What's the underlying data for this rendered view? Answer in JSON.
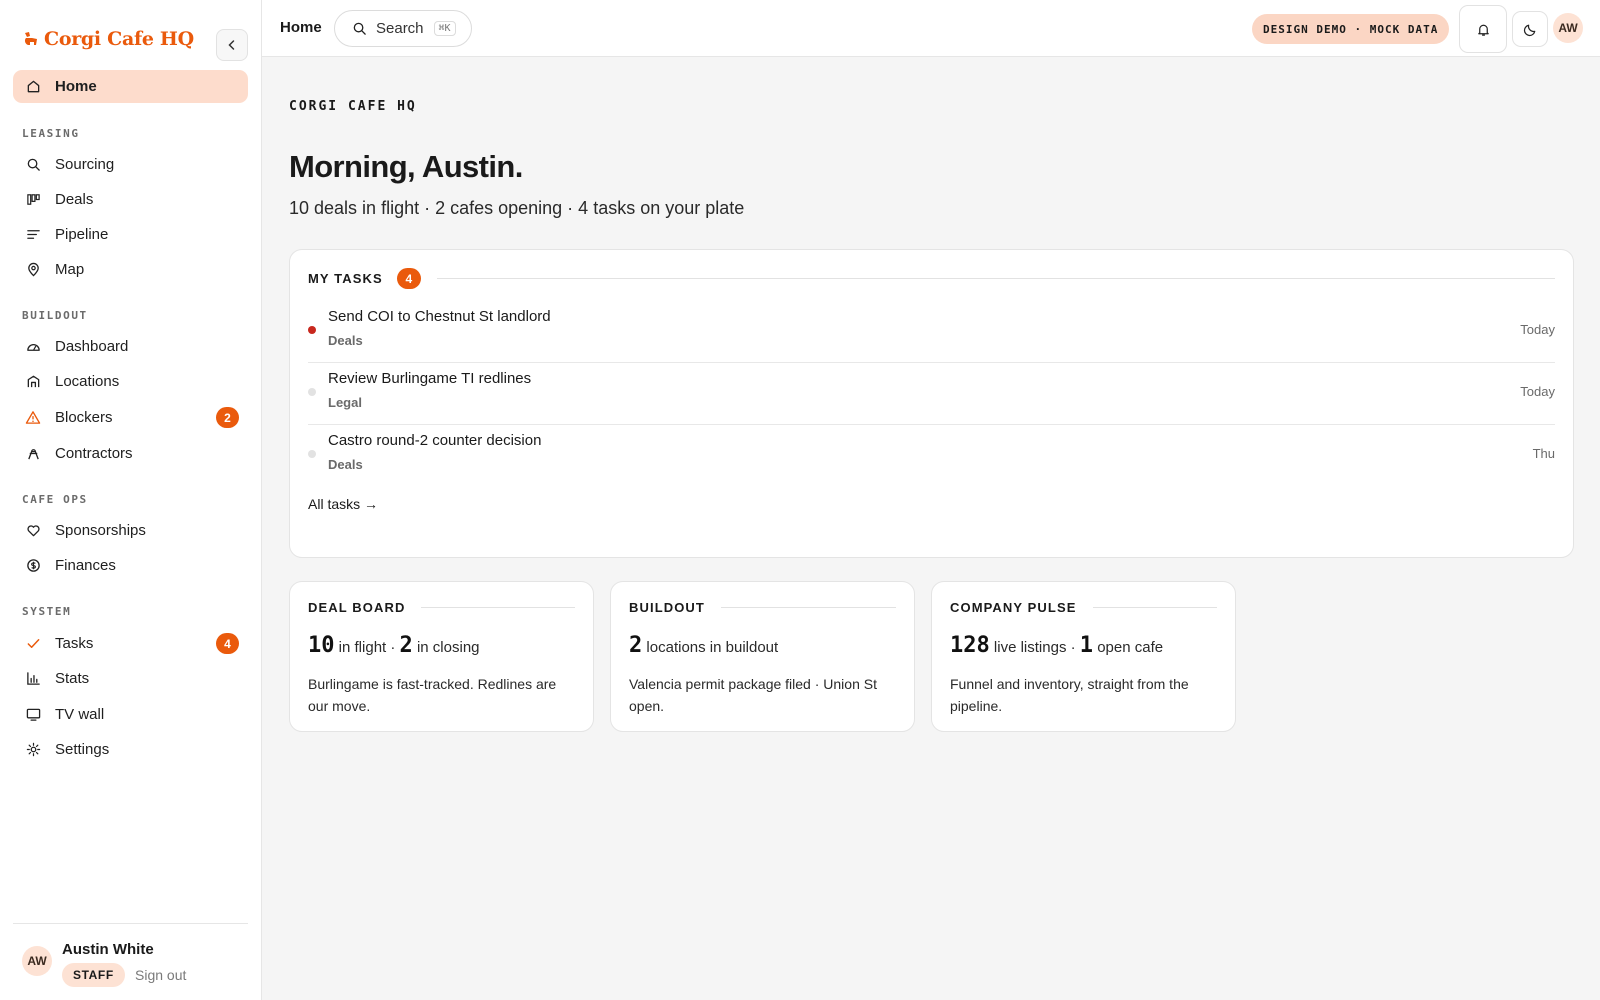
{
  "brand": {
    "name": "Corgi Cafe HQ",
    "accent": "#ea5a0c"
  },
  "sidebar": {
    "home": {
      "label": "Home",
      "icon": "home-icon"
    },
    "sections": [
      {
        "label": "LEASING",
        "items": [
          {
            "label": "Sourcing",
            "icon": "search-icon"
          },
          {
            "label": "Deals",
            "icon": "board-icon"
          },
          {
            "label": "Pipeline",
            "icon": "lines-icon"
          },
          {
            "label": "Map",
            "icon": "map-pin-icon"
          }
        ]
      },
      {
        "label": "BUILDOUT",
        "items": [
          {
            "label": "Dashboard",
            "icon": "gauge-icon"
          },
          {
            "label": "Locations",
            "icon": "building-icon"
          },
          {
            "label": "Blockers",
            "icon": "warning-icon",
            "badge": "2"
          },
          {
            "label": "Contractors",
            "icon": "worker-icon"
          }
        ]
      },
      {
        "label": "CAFE OPS",
        "items": [
          {
            "label": "Sponsorships",
            "icon": "heart-icon"
          },
          {
            "label": "Finances",
            "icon": "dollar-icon"
          }
        ]
      },
      {
        "label": "SYSTEM",
        "items": [
          {
            "label": "Tasks",
            "icon": "check-icon",
            "badge": "4"
          },
          {
            "label": "Stats",
            "icon": "bar-chart-icon"
          },
          {
            "label": "TV wall",
            "icon": "monitor-icon"
          },
          {
            "label": "Settings",
            "icon": "gear-icon"
          }
        ]
      }
    ],
    "user": {
      "initials": "AW",
      "name": "Austin White",
      "role": "STAFF",
      "signout": "Sign out"
    }
  },
  "topbar": {
    "crumb": "Home",
    "search": {
      "label": "Search",
      "shortcut": "⌘K"
    },
    "demo": "DESIGN DEMO · MOCK DATA",
    "avatar": "AW"
  },
  "main": {
    "eyebrow": "CORGI CAFE HQ",
    "greeting": "Morning, Austin.",
    "summary": "10 deals in flight · 2 cafes opening · 4 tasks on your plate",
    "tasks": {
      "title": "MY TASKS",
      "count": "4",
      "items": [
        {
          "title": "Send COI to Chestnut St landlord",
          "tag": "Deals",
          "when": "Today",
          "urgent": true
        },
        {
          "title": "Review Burlingame TI redlines",
          "tag": "Legal",
          "when": "Today",
          "urgent": false
        },
        {
          "title": "Castro round-2 counter decision",
          "tag": "Deals",
          "when": "Thu",
          "urgent": false
        }
      ],
      "all_link": "All tasks →"
    },
    "cards": [
      {
        "title": "DEAL BOARD",
        "n1": "10",
        "t1": "in flight ·",
        "n2": "2",
        "t2": "in closing",
        "desc": "Burlingame is fast-tracked. Redlines are our move."
      },
      {
        "title": "BUILDOUT",
        "n1": "2",
        "t1": "locations in buildout",
        "n2": "",
        "t2": "",
        "desc": "Valencia permit package filed · Union St open."
      },
      {
        "title": "COMPANY PULSE",
        "n1": "128",
        "t1": "live listings ·",
        "n2": "1",
        "t2": "open cafe",
        "desc": "Funnel and inventory, straight from the pipeline."
      }
    ]
  }
}
